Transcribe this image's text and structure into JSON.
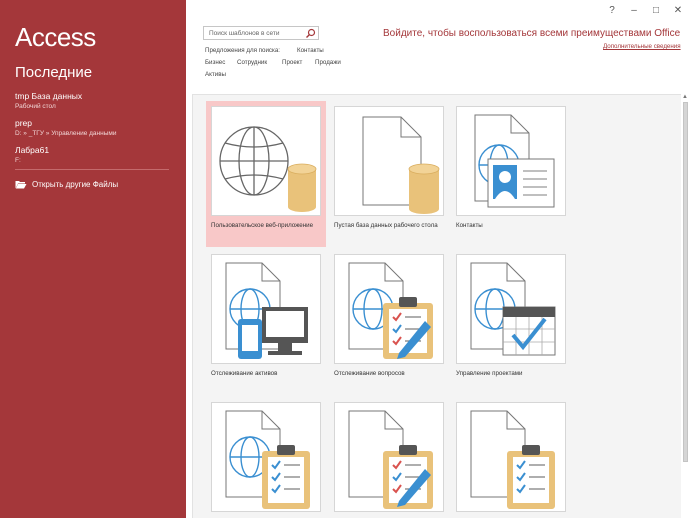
{
  "sidebar": {
    "app_title": "Access",
    "recent_heading": "Последние",
    "recent_items": [
      {
        "name": "tmp База данных",
        "path": "Рабочий стол"
      },
      {
        "name": "prep",
        "path": "D: » _ТГУ » Управление данными"
      },
      {
        "name": "Лабра61",
        "path": "F:"
      }
    ],
    "open_other_label": "Открыть другие Файлы"
  },
  "window": {
    "help": "?",
    "minimize": "–",
    "maximize": "□",
    "close": "✕"
  },
  "search": {
    "placeholder": "Поиск шаблонов в сети",
    "icon": "search-icon"
  },
  "suggestions": {
    "label": "Предложения для поиска:",
    "items": [
      "Контакты",
      "Бизнес",
      "Сотрудник",
      "Проект",
      "Продажи",
      "Активы"
    ]
  },
  "signin": {
    "text": "Войдите, чтобы воспользоваться всеми преимуществами Office",
    "link": "Дополнительные сведения"
  },
  "templates": [
    {
      "caption": "Пользовательское веб-приложение",
      "selected": true,
      "icon": "web-app-icon"
    },
    {
      "caption": "Пустая база данных рабочего стола",
      "selected": false,
      "icon": "blank-database-icon"
    },
    {
      "caption": "Контакты",
      "selected": false,
      "icon": "contacts-icon"
    },
    {
      "caption": "Отслеживание активов",
      "selected": false,
      "icon": "asset-tracking-icon"
    },
    {
      "caption": "Отслеживание вопросов",
      "selected": false,
      "icon": "issue-tracking-icon"
    },
    {
      "caption": "Управление проектами",
      "selected": false,
      "icon": "project-management-icon"
    },
    {
      "caption": "",
      "selected": false,
      "icon": "checklist-icon"
    },
    {
      "caption": "",
      "selected": false,
      "icon": "edit-checklist-icon"
    },
    {
      "caption": "",
      "selected": false,
      "icon": "checklist-icon"
    }
  ],
  "colors": {
    "accent": "#a4373a",
    "db_cylinder": "#e9c27a",
    "globe": "#3a8fd1"
  }
}
